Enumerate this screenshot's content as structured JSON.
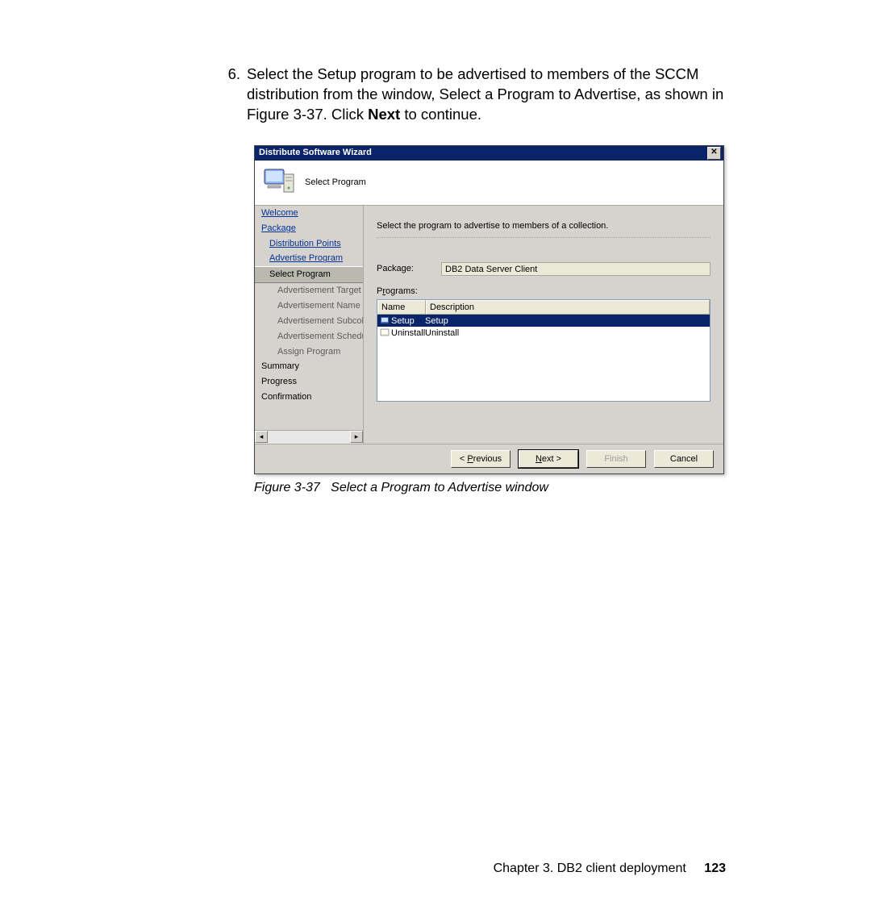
{
  "step": {
    "number": "6.",
    "line1": "Select the Setup program to be advertised to members of the SCCM ",
    "line2": "distribution from the window, Select a Program to Advertise, as shown in ",
    "line3a": "Figure 3-37. Click ",
    "bold": "Next",
    "line3b": " to continue."
  },
  "wizard": {
    "title": "Distribute Software Wizard",
    "page_title": "Select Program",
    "instruction": "Select the program to advertise to members of a collection.",
    "package_label": "Package:",
    "package_value": "DB2 Data Server Client",
    "programs_label_pre": "P",
    "programs_label_u": "r",
    "programs_label_post": "ograms:",
    "columns": [
      "Name",
      "Description"
    ],
    "programs": [
      {
        "name": "Setup",
        "desc": "Setup"
      },
      {
        "name": "Uninstall",
        "desc": "Uninstall"
      }
    ],
    "sidebar": [
      "Welcome",
      "Package",
      "Distribution Points",
      "Advertise Program",
      "Select Program",
      "Advertisement Target",
      "Advertisement Name",
      "Advertisement Subcollec",
      "Advertisement Schedule",
      "Assign Program",
      "Summary",
      "Progress",
      "Confirmation"
    ],
    "buttons": {
      "prev_u": "P",
      "prev_rest": "revious",
      "next_u": "N",
      "next_rest": "ext",
      "finish": "Finish",
      "cancel": "Cancel"
    }
  },
  "caption": {
    "label": "Figure 3-37",
    "text": "Select a Program to Advertise window"
  },
  "footer": {
    "chapter": "Chapter 3. DB2 client deployment",
    "page": "123"
  }
}
